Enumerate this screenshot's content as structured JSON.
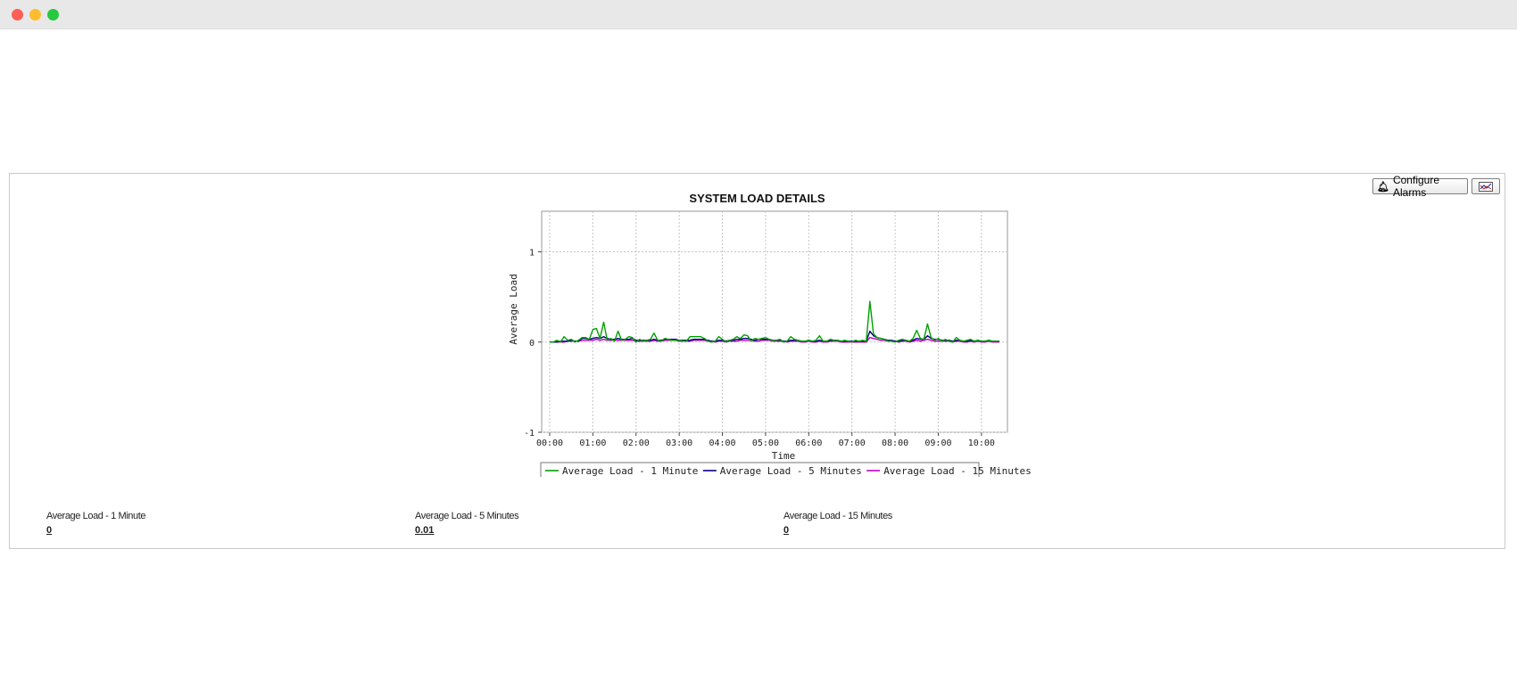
{
  "window": {
    "controls": [
      "close",
      "minimize",
      "maximize"
    ]
  },
  "toolbar": {
    "configure_alarms_label": "Configure Alarms",
    "configure_alarms_icon": "bell-icon",
    "export_icon": "chart-export-icon"
  },
  "metrics": [
    {
      "label": "Average Load - 1 Minute",
      "value": "0"
    },
    {
      "label": "Average Load - 5 Minutes",
      "value": "0.01"
    },
    {
      "label": "Average Load - 15 Minutes",
      "value": "0"
    }
  ],
  "chart_data": {
    "type": "line",
    "title": "SYSTEM LOAD DETAILS",
    "xlabel": "Time",
    "ylabel": "Average Load",
    "x_ticks": [
      "00:00",
      "01:00",
      "02:00",
      "03:00",
      "04:00",
      "05:00",
      "06:00",
      "07:00",
      "08:00",
      "09:00",
      "10:00"
    ],
    "y_ticks": [
      "-1",
      "0",
      "1"
    ],
    "xlim": [
      "00:00",
      "10:25"
    ],
    "ylim": [
      -1,
      1.45
    ],
    "grid": true,
    "legend_position": "bottom",
    "x": [
      "00:00",
      "00:05",
      "00:10",
      "00:15",
      "00:20",
      "00:25",
      "00:30",
      "00:35",
      "00:40",
      "00:45",
      "00:50",
      "00:55",
      "01:00",
      "01:05",
      "01:10",
      "01:15",
      "01:20",
      "01:25",
      "01:30",
      "01:35",
      "01:40",
      "01:45",
      "01:50",
      "01:55",
      "02:00",
      "02:05",
      "02:10",
      "02:15",
      "02:20",
      "02:25",
      "02:30",
      "02:35",
      "02:40",
      "02:45",
      "02:50",
      "02:55",
      "03:00",
      "03:05",
      "03:10",
      "03:15",
      "03:20",
      "03:25",
      "03:30",
      "03:35",
      "03:40",
      "03:45",
      "03:50",
      "03:55",
      "04:00",
      "04:05",
      "04:10",
      "04:15",
      "04:20",
      "04:25",
      "04:30",
      "04:35",
      "04:40",
      "04:45",
      "04:50",
      "04:55",
      "05:00",
      "05:05",
      "05:10",
      "05:15",
      "05:20",
      "05:25",
      "05:30",
      "05:35",
      "05:40",
      "05:45",
      "05:50",
      "05:55",
      "06:00",
      "06:05",
      "06:10",
      "06:15",
      "06:20",
      "06:25",
      "06:30",
      "06:35",
      "06:40",
      "06:45",
      "06:50",
      "06:55",
      "07:00",
      "07:05",
      "07:10",
      "07:15",
      "07:20",
      "07:25",
      "07:30",
      "07:35",
      "07:40",
      "07:45",
      "07:50",
      "07:55",
      "08:00",
      "08:05",
      "08:10",
      "08:15",
      "08:20",
      "08:25",
      "08:30",
      "08:35",
      "08:40",
      "08:45",
      "08:50",
      "08:55",
      "09:00",
      "09:05",
      "09:10",
      "09:15",
      "09:20",
      "09:25",
      "09:30",
      "09:35",
      "09:40",
      "09:45",
      "09:50",
      "09:55",
      "10:00",
      "10:05",
      "10:10",
      "10:15",
      "10:20",
      "10:25"
    ],
    "series": [
      {
        "name": "Average Load - 1 Minute",
        "color": "#00a000",
        "values": [
          0,
          0,
          0.02,
          0,
          0.06,
          0.02,
          0.03,
          0,
          0.02,
          0.05,
          0.05,
          0.03,
          0.14,
          0.15,
          0.04,
          0.22,
          0.02,
          0.04,
          0.01,
          0.12,
          0.02,
          0.03,
          0.06,
          0.05,
          0,
          0.03,
          0.01,
          0.02,
          0.03,
          0.1,
          0.02,
          0.01,
          0.04,
          0.03,
          0.02,
          0.02,
          0.02,
          0.01,
          0.01,
          0.06,
          0.06,
          0.06,
          0.06,
          0.04,
          0.01,
          0,
          0.01,
          0.06,
          0.03,
          0,
          0.02,
          0.03,
          0.06,
          0.04,
          0.08,
          0.07,
          0.01,
          0.04,
          0.03,
          0.04,
          0.05,
          0.03,
          0.02,
          0.02,
          0.03,
          0,
          0.01,
          0.06,
          0.03,
          0.02,
          0.01,
          0.01,
          0.02,
          0.01,
          0.02,
          0.07,
          0.01,
          0.01,
          0.03,
          0.02,
          0.02,
          0.01,
          0.02,
          0.01,
          0,
          0.02,
          0.01,
          0.02,
          0.01,
          0.45,
          0.09,
          0.05,
          0.04,
          0.03,
          0.01,
          0.01,
          0,
          0.02,
          0.03,
          0.02,
          0.01,
          0.04,
          0.13,
          0.04,
          0.03,
          0.2,
          0.05,
          0.02,
          0.04,
          0.01,
          0.03,
          0.01,
          0,
          0.05,
          0.02,
          0.01,
          0.02,
          0.03,
          0.01,
          0.02,
          0.01,
          0.01,
          0.02,
          0.01,
          0.01,
          0.01
        ]
      },
      {
        "name": "Average Load - 5 Minutes",
        "color": "#000080",
        "values": [
          0,
          0,
          0,
          0.01,
          0.01,
          0.01,
          0.02,
          0.01,
          0.01,
          0.04,
          0.04,
          0.03,
          0.04,
          0.05,
          0.04,
          0.06,
          0.04,
          0.03,
          0.03,
          0.04,
          0.03,
          0.03,
          0.03,
          0.04,
          0.02,
          0.02,
          0.02,
          0.02,
          0.02,
          0.03,
          0.02,
          0.02,
          0.03,
          0.03,
          0.03,
          0.03,
          0.02,
          0.02,
          0.02,
          0.02,
          0.03,
          0.03,
          0.03,
          0.03,
          0.02,
          0.01,
          0.01,
          0.02,
          0.02,
          0.01,
          0.02,
          0.02,
          0.03,
          0.03,
          0.04,
          0.04,
          0.03,
          0.02,
          0.03,
          0.03,
          0.03,
          0.03,
          0.02,
          0.02,
          0.02,
          0.01,
          0.01,
          0.02,
          0.02,
          0.02,
          0.01,
          0.01,
          0.02,
          0.01,
          0.01,
          0.02,
          0.01,
          0.01,
          0.02,
          0.02,
          0.02,
          0.01,
          0.01,
          0.01,
          0.01,
          0.01,
          0.01,
          0.01,
          0.01,
          0.12,
          0.07,
          0.05,
          0.04,
          0.03,
          0.02,
          0.02,
          0.01,
          0.01,
          0.02,
          0.02,
          0.01,
          0.02,
          0.04,
          0.03,
          0.03,
          0.07,
          0.04,
          0.03,
          0.03,
          0.02,
          0.02,
          0.02,
          0.01,
          0.02,
          0.02,
          0.01,
          0.01,
          0.02,
          0.01,
          0.02,
          0.01,
          0.01,
          0.02,
          0.01,
          0.01,
          0.01
        ]
      },
      {
        "name": "Average Load - 15 Minutes",
        "color": "#c000c0",
        "values": [
          0,
          0,
          0,
          0,
          0,
          0.01,
          0.01,
          0.01,
          0.01,
          0.02,
          0.02,
          0.02,
          0.02,
          0.03,
          0.02,
          0.03,
          0.02,
          0.02,
          0.02,
          0.02,
          0.02,
          0.02,
          0.02,
          0.02,
          0.01,
          0.01,
          0.01,
          0.01,
          0.01,
          0.02,
          0.01,
          0.01,
          0.02,
          0.02,
          0.02,
          0.02,
          0.01,
          0.01,
          0.01,
          0.01,
          0.02,
          0.02,
          0.02,
          0.02,
          0.01,
          0.01,
          0,
          0.01,
          0.01,
          0,
          0.01,
          0.01,
          0.01,
          0.02,
          0.02,
          0.02,
          0.02,
          0.01,
          0.01,
          0.02,
          0.02,
          0.02,
          0.01,
          0.01,
          0.01,
          0.01,
          0,
          0.01,
          0.01,
          0.01,
          0,
          0,
          0.01,
          0,
          0,
          0.01,
          0,
          0,
          0.01,
          0.01,
          0.01,
          0,
          0,
          0,
          0,
          0,
          0,
          0,
          0,
          0.05,
          0.04,
          0.03,
          0.02,
          0.02,
          0.01,
          0.01,
          0.01,
          0,
          0.01,
          0.01,
          0,
          0.01,
          0.02,
          0.01,
          0.02,
          0.03,
          0.02,
          0.01,
          0.01,
          0.01,
          0.01,
          0.01,
          0,
          0.01,
          0.01,
          0,
          0,
          0.01,
          0,
          0.01,
          0,
          0,
          0.01,
          0,
          0,
          0
        ]
      }
    ]
  }
}
